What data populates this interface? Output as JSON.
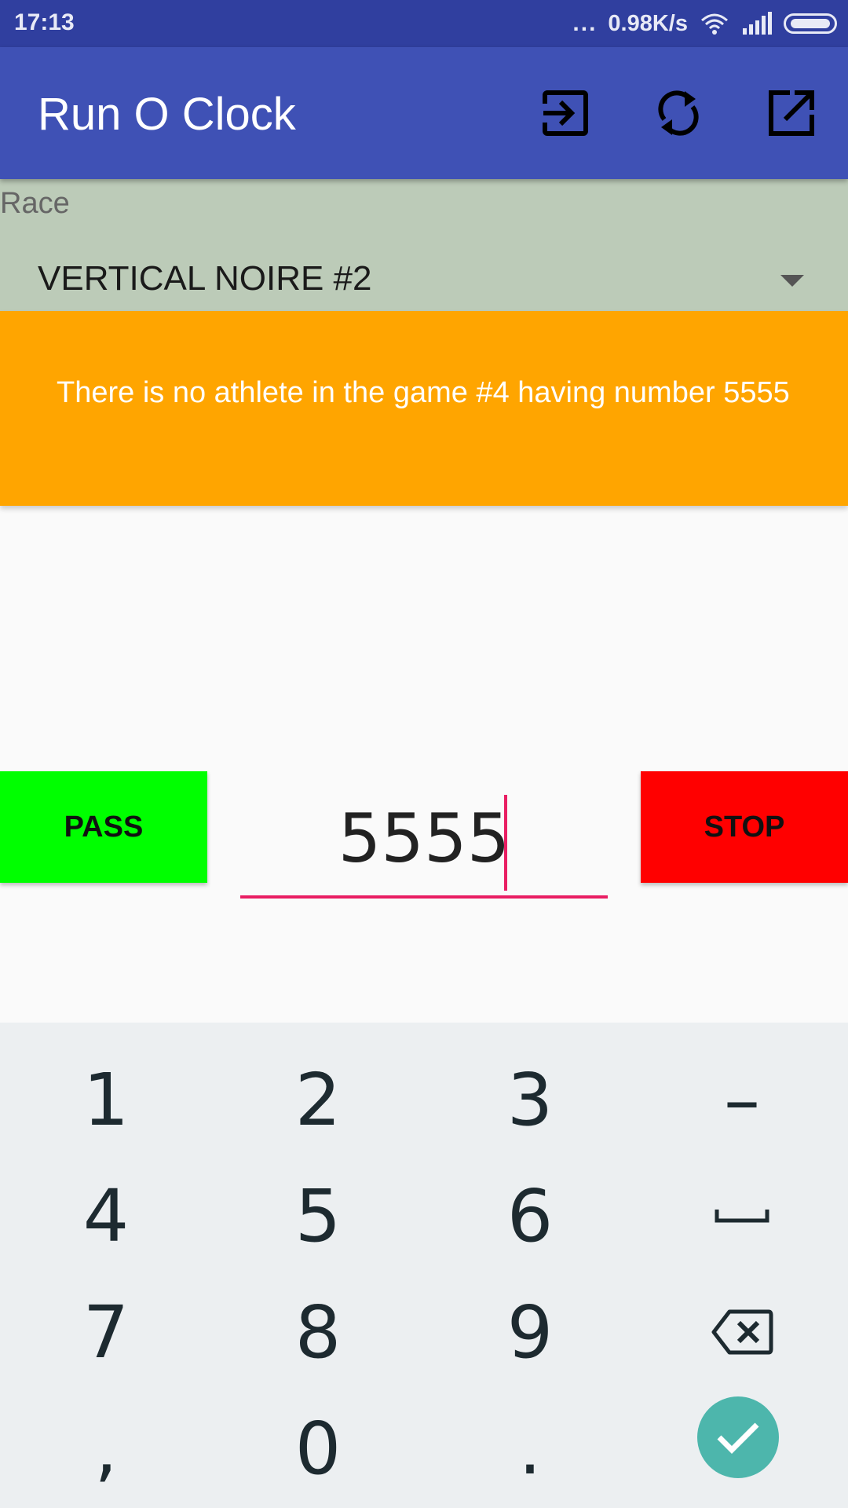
{
  "status_bar": {
    "time": "17:13",
    "dots": "...",
    "net_speed": "0.98K/s"
  },
  "app_bar": {
    "title": "Run O Clock",
    "icons": [
      "exit-to-app-icon",
      "sync-icon",
      "open-in-new-icon"
    ]
  },
  "race": {
    "label": "Race",
    "selected": "VERTICAL NOIRE #2"
  },
  "banner": {
    "message": "There is no athlete in the game #4 having number 5555",
    "color": "#ffa500"
  },
  "controls": {
    "pass_label": "PASS",
    "stop_label": "STOP",
    "number_value": "5555",
    "pass_color": "#00ff00",
    "stop_color": "#ff0000"
  },
  "keypad": {
    "keys": [
      "1",
      "2",
      "3",
      "–",
      "4",
      "5",
      "6",
      "␣",
      "7",
      "8",
      "9",
      "⌫",
      ",",
      "0",
      "."
    ]
  },
  "colors": {
    "primary": "#3f51b5",
    "primary_dark": "#303f9f",
    "accent": "#e91e63",
    "race_bg": "#bccbb8",
    "ok_button": "#4db6ac"
  }
}
